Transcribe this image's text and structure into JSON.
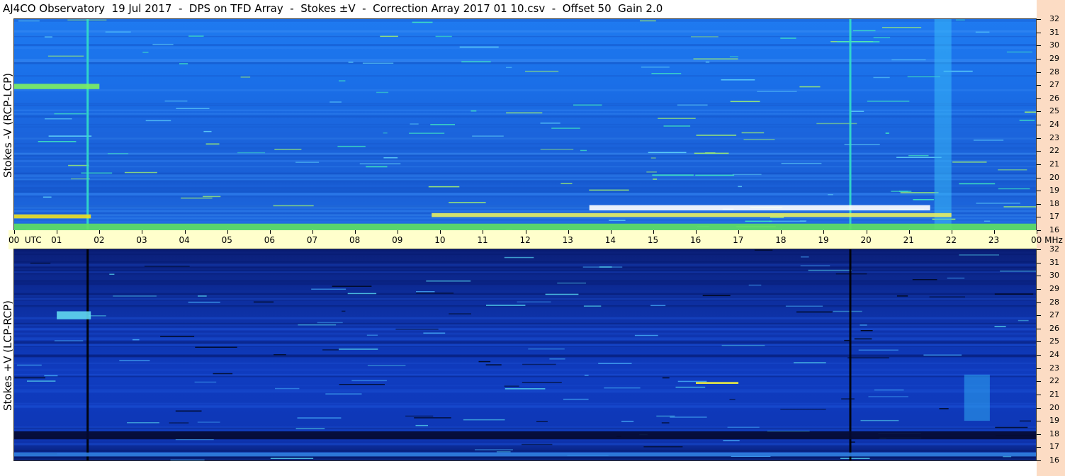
{
  "title": "AJ4CO Observatory  19 Jul 2017  -  DPS on TFD Array  -  Stokes ±V  -  Correction Array 2017 01 10.csv  -  Offset 50  Gain 2.0",
  "colors": {
    "time_strip": "#ffffcc",
    "freq_strip": "#fcdcc4",
    "top_base": "#1f6fe8",
    "bottom_base": "#0e34b0"
  },
  "chart_data": [
    {
      "type": "heatmap",
      "ylabel": "Stokes -V (RCP-LCP)",
      "x_unit": "UTC",
      "y_unit": "MHz",
      "xlim": [
        0,
        24
      ],
      "ylim": [
        16,
        32
      ],
      "x_ticks": [
        "00",
        "01",
        "02",
        "03",
        "04",
        "05",
        "06",
        "07",
        "08",
        "09",
        "10",
        "11",
        "12",
        "13",
        "14",
        "15",
        "16",
        "17",
        "18",
        "19",
        "20",
        "21",
        "22",
        "23",
        "00"
      ],
      "y_ticks": [
        "16",
        "17",
        "18",
        "19",
        "20",
        "21",
        "22",
        "23",
        "24",
        "25",
        "26",
        "27",
        "28",
        "29",
        "30",
        "31",
        "32"
      ],
      "features": [
        {
          "hour_start": 1.7,
          "hour_end": 1.75,
          "freq_low": 16,
          "freq_high": 32,
          "color": "#33e0c8"
        },
        {
          "hour_start": 19.6,
          "hour_end": 19.65,
          "freq_low": 16,
          "freq_high": 32,
          "color": "#33e0c8"
        },
        {
          "hour_start": 21.6,
          "hour_end": 22.0,
          "freq_low": 16,
          "freq_high": 32,
          "color": "#38b8f8"
        },
        {
          "hour_start": 0.0,
          "hour_end": 1.8,
          "freq_low": 16.9,
          "freq_high": 17.2,
          "color": "#f0e020"
        },
        {
          "hour_start": 9.8,
          "hour_end": 22.0,
          "freq_low": 17.0,
          "freq_high": 17.3,
          "color": "#e8f060"
        },
        {
          "hour_start": 13.5,
          "hour_end": 21.5,
          "freq_low": 17.5,
          "freq_high": 17.9,
          "color": "#ffffff"
        },
        {
          "hour_start": 0.0,
          "hour_end": 2.0,
          "freq_low": 26.7,
          "freq_high": 27.1,
          "color": "#80f060"
        },
        {
          "hour_start": 0.0,
          "hour_end": 24.0,
          "freq_low": 16.0,
          "freq_high": 16.5,
          "color": "#60e060"
        }
      ]
    },
    {
      "type": "heatmap",
      "ylabel": "Stokes +V (LCP-RCP)",
      "x_unit": "UTC",
      "y_unit": "MHz",
      "xlim": [
        0,
        24
      ],
      "ylim": [
        16,
        32
      ],
      "x_ticks": [
        "00",
        "01",
        "02",
        "03",
        "04",
        "05",
        "06",
        "07",
        "08",
        "09",
        "10",
        "11",
        "12",
        "13",
        "14",
        "15",
        "16",
        "17",
        "18",
        "19",
        "20",
        "21",
        "22",
        "23",
        "00"
      ],
      "y_ticks": [
        "16",
        "17",
        "18",
        "19",
        "20",
        "21",
        "22",
        "23",
        "24",
        "25",
        "26",
        "27",
        "28",
        "29",
        "30",
        "31",
        "32"
      ],
      "features": [
        {
          "hour_start": 1.7,
          "hour_end": 1.75,
          "freq_low": 16,
          "freq_high": 32,
          "color": "#000000"
        },
        {
          "hour_start": 19.6,
          "hour_end": 19.65,
          "freq_low": 16,
          "freq_high": 32,
          "color": "#000000"
        },
        {
          "hour_start": 22.3,
          "hour_end": 22.9,
          "freq_low": 19.0,
          "freq_high": 22.5,
          "color": "#30a8f0"
        },
        {
          "hour_start": 1.0,
          "hour_end": 1.8,
          "freq_low": 26.7,
          "freq_high": 27.3,
          "color": "#60d8f0"
        },
        {
          "hour_start": 16.0,
          "hour_end": 17.0,
          "freq_low": 21.8,
          "freq_high": 21.95,
          "color": "#f0f040"
        },
        {
          "hour_start": 0.0,
          "hour_end": 24.0,
          "freq_low": 17.6,
          "freq_high": 18.2,
          "color": "#050a30"
        },
        {
          "hour_start": 0.0,
          "hour_end": 24.0,
          "freq_low": 16.3,
          "freq_high": 16.6,
          "color": "#3080e0"
        }
      ]
    }
  ]
}
